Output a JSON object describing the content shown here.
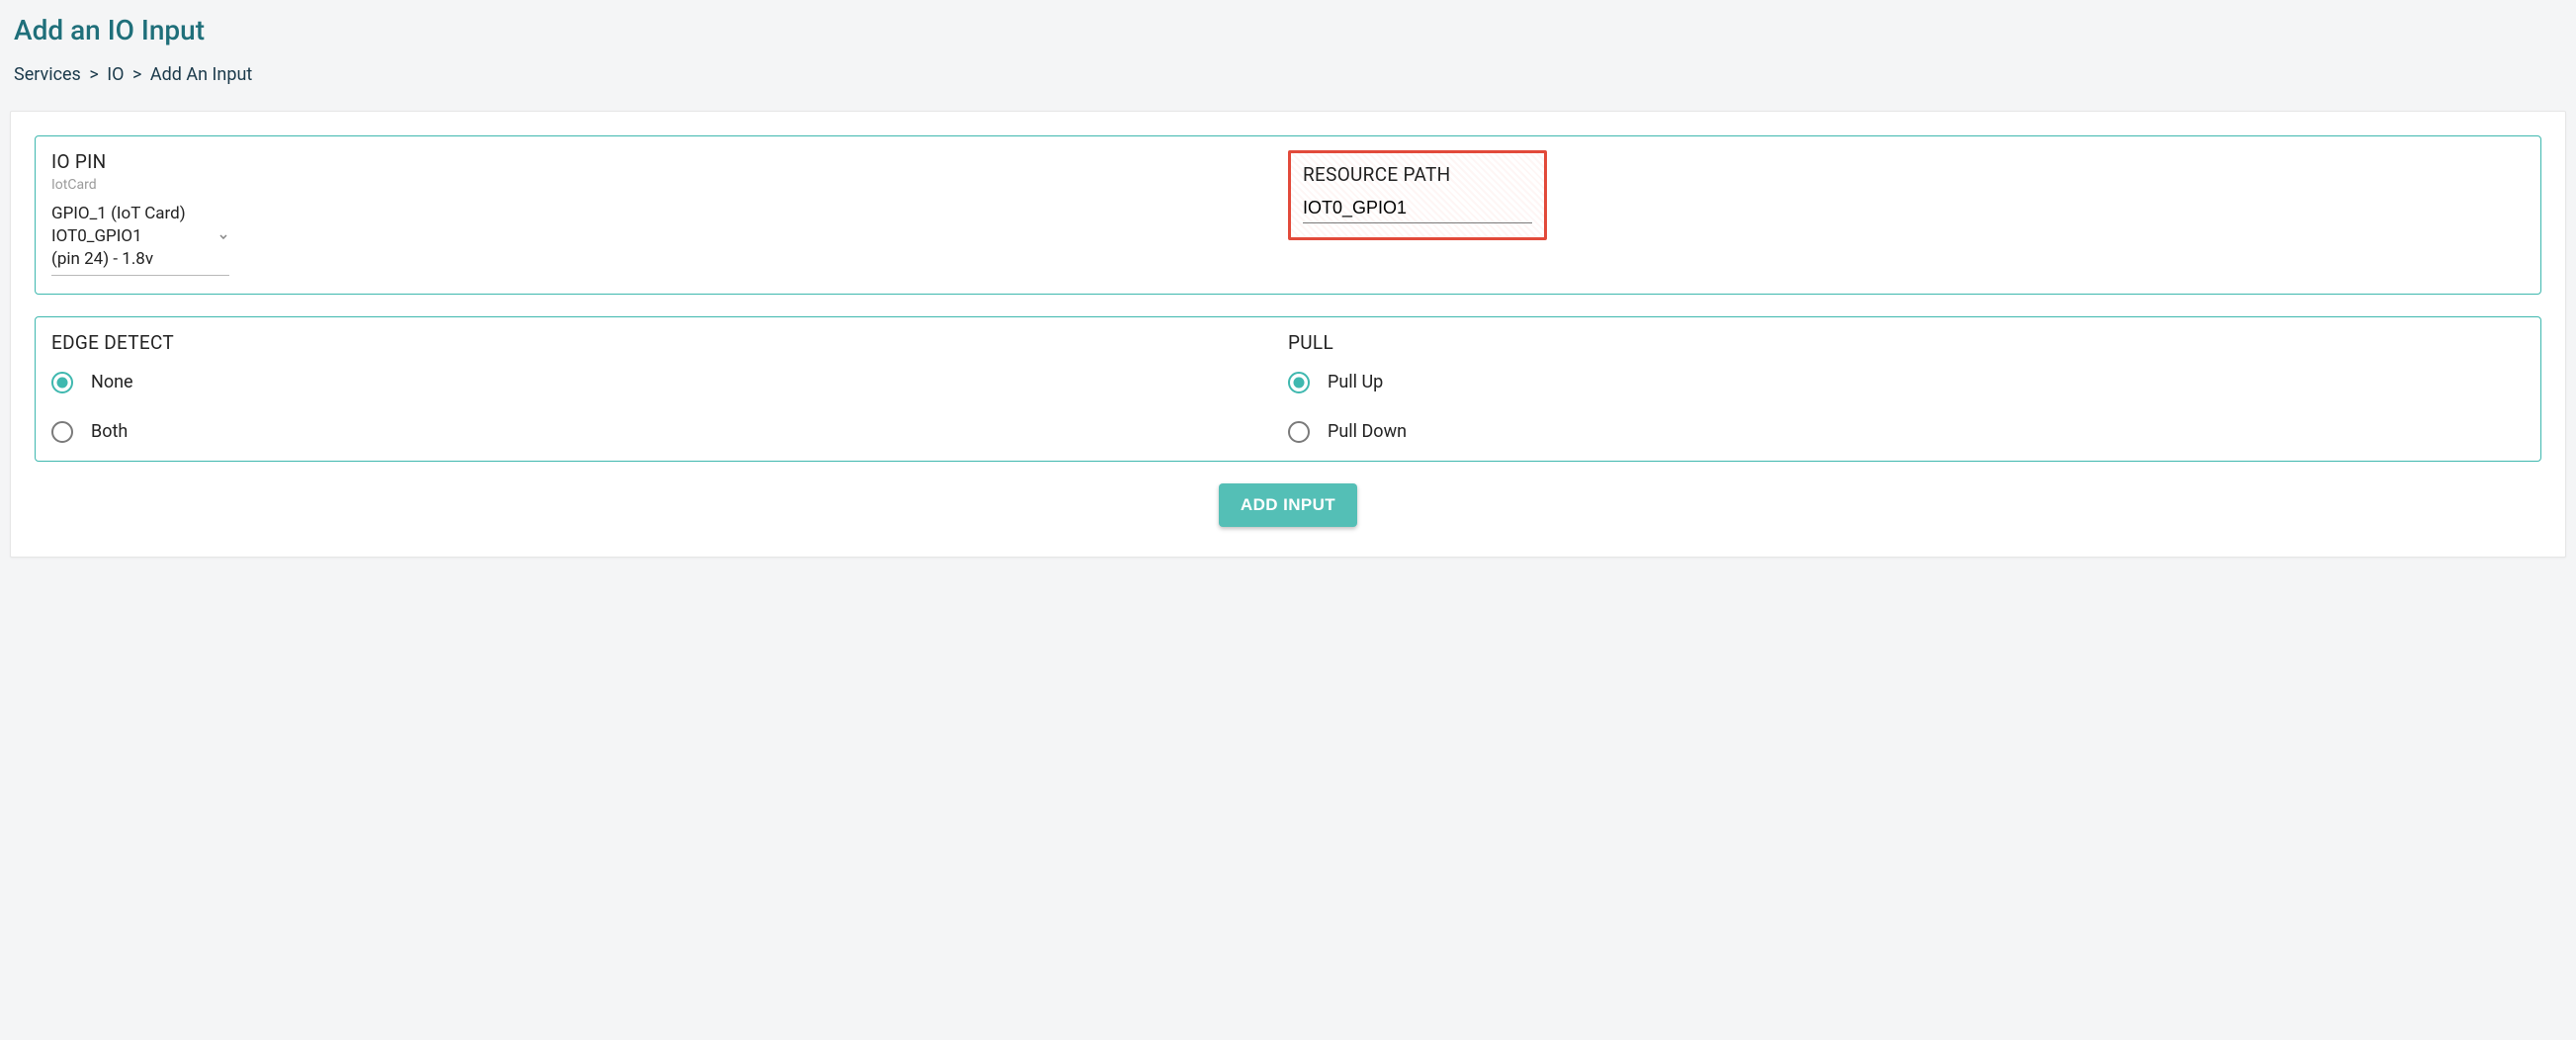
{
  "title": "Add an IO Input",
  "breadcrumbs": {
    "services": "Services",
    "io": "IO",
    "current": "Add An Input",
    "sep": ">"
  },
  "io_pin": {
    "heading": "IO PIN",
    "sub": "IotCard",
    "select_line1": "GPIO_1 (IoT Card)",
    "select_line2": "IOT0_GPIO1",
    "select_line3": "(pin 24) - 1.8v"
  },
  "resource_path": {
    "heading": "RESOURCE PATH",
    "value": "IOT0_GPIO1"
  },
  "edge_detect": {
    "heading": "EDGE DETECT",
    "options": [
      {
        "label": "None",
        "selected": true
      },
      {
        "label": "Both",
        "selected": false
      }
    ]
  },
  "pull": {
    "heading": "PULL",
    "options": [
      {
        "label": "Pull Up",
        "selected": true
      },
      {
        "label": "Pull Down",
        "selected": false
      }
    ]
  },
  "button": {
    "add_input": "ADD INPUT"
  }
}
